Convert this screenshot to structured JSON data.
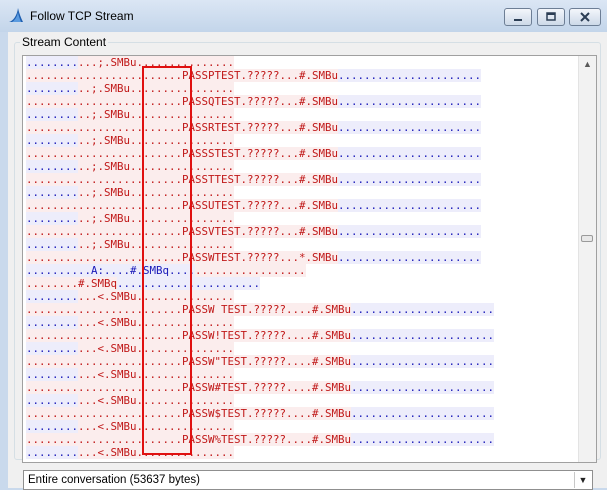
{
  "window": {
    "title": "Follow TCP Stream"
  },
  "icons": {
    "app": "shark-fin-icon",
    "minimize": "minimize-icon",
    "maximize": "maximize-icon",
    "close": "close-icon",
    "scroll_up": "scroll-up-arrow-icon",
    "dropdown": "chevron-down-icon"
  },
  "colors": {
    "client_bg": "#fbeded",
    "client_fg": "#c01818",
    "server_bg": "#ededfb",
    "server_fg": "#1818b8",
    "highlight": "#e01010"
  },
  "group": {
    "label": "Stream Content"
  },
  "stream_lines": [
    [
      [
        "s",
        "........"
      ],
      [
        "c",
        "...;.SMBu..............."
      ]
    ],
    [
      [
        "c",
        "........................PASSPTEST.?????...#.SMBu"
      ],
      [
        "s",
        "......................"
      ]
    ],
    [
      [
        "s",
        "........"
      ],
      [
        "c",
        "..;.SMBu................"
      ]
    ],
    [
      [
        "c",
        "........................PASSQTEST.?????...#.SMBu"
      ],
      [
        "s",
        "......................"
      ]
    ],
    [
      [
        "s",
        "........"
      ],
      [
        "c",
        "..;.SMBu................"
      ]
    ],
    [
      [
        "c",
        "........................PASSRTEST.?????...#.SMBu"
      ],
      [
        "s",
        "......................"
      ]
    ],
    [
      [
        "s",
        "........"
      ],
      [
        "c",
        "..;.SMBu................"
      ]
    ],
    [
      [
        "c",
        "........................PASSSTEST.?????...#.SMBu"
      ],
      [
        "s",
        "......................"
      ]
    ],
    [
      [
        "s",
        "........"
      ],
      [
        "c",
        "..;.SMBu................"
      ]
    ],
    [
      [
        "c",
        "........................PASSTTEST.?????...#.SMBu"
      ],
      [
        "s",
        "......................"
      ]
    ],
    [
      [
        "s",
        "........"
      ],
      [
        "c",
        "..;.SMBu................"
      ]
    ],
    [
      [
        "c",
        "........................PASSUTEST.?????...#.SMBu"
      ],
      [
        "s",
        "......................"
      ]
    ],
    [
      [
        "s",
        "........"
      ],
      [
        "c",
        "..;.SMBu................"
      ]
    ],
    [
      [
        "c",
        "........................PASSVTEST.?????...#.SMBu"
      ],
      [
        "s",
        "......................"
      ]
    ],
    [
      [
        "s",
        "........"
      ],
      [
        "c",
        "..;.SMBu................"
      ]
    ],
    [
      [
        "c",
        "........................PASSWTEST.?????...*.SMBu"
      ],
      [
        "s",
        "......................"
      ]
    ],
    [
      [
        "s",
        "..........A:....#.SMBq...."
      ],
      [
        "c",
        "................."
      ]
    ],
    [
      [
        "c",
        "........#.SMBq"
      ],
      [
        "s",
        "......................"
      ]
    ],
    [
      [
        "s",
        "........"
      ],
      [
        "c",
        "...<.SMBu..............."
      ]
    ],
    [
      [
        "c",
        "........................PASSW TEST.?????....#.SMBu"
      ],
      [
        "s",
        "......................"
      ]
    ],
    [
      [
        "s",
        "........"
      ],
      [
        "c",
        "...<.SMBu..............."
      ]
    ],
    [
      [
        "c",
        "........................PASSW!TEST.?????....#.SMBu"
      ],
      [
        "s",
        "......................"
      ]
    ],
    [
      [
        "s",
        "........"
      ],
      [
        "c",
        "...<.SMBu..............."
      ]
    ],
    [
      [
        "c",
        "........................PASSW\"TEST.?????....#.SMBu"
      ],
      [
        "s",
        "......................"
      ]
    ],
    [
      [
        "s",
        "........"
      ],
      [
        "c",
        "...<.SMBu..............."
      ]
    ],
    [
      [
        "c",
        "........................PASSW#TEST.?????....#.SMBu"
      ],
      [
        "s",
        "......................"
      ]
    ],
    [
      [
        "s",
        "........"
      ],
      [
        "c",
        "...<.SMBu..............."
      ]
    ],
    [
      [
        "c",
        "........................PASSW$TEST.?????....#.SMBu"
      ],
      [
        "s",
        "......................"
      ]
    ],
    [
      [
        "s",
        "........"
      ],
      [
        "c",
        "...<.SMBu..............."
      ]
    ],
    [
      [
        "c",
        "........................PASSW%TEST.?????....#.SMBu"
      ],
      [
        "s",
        "......................"
      ]
    ],
    [
      [
        "s",
        "........"
      ],
      [
        "c",
        "...<.SMBu..............."
      ]
    ]
  ],
  "conversation_select": {
    "value": "Entire conversation (53637 bytes)"
  }
}
